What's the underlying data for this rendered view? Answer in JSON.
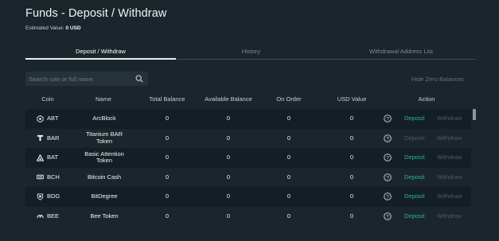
{
  "page": {
    "title": "Funds - Deposit / Withdraw",
    "estimated_label": "Estimated Value:",
    "estimated_value": "0 USD"
  },
  "tabs": [
    {
      "label": "Deposit / Withdraw",
      "active": true
    },
    {
      "label": "History",
      "active": false
    },
    {
      "label": "Withdrawal Address List",
      "active": false
    }
  ],
  "search": {
    "placeholder": "Search coin or full name",
    "value": "",
    "icon": "search-icon"
  },
  "hide_zero_label": "Hide Zero Balances",
  "table": {
    "headers": {
      "coin": "Coin",
      "name": "Name",
      "total": "Total Balance",
      "available": "Available Balance",
      "on_order": "On Order",
      "usd": "USD Value",
      "action": "Action"
    },
    "rows": [
      {
        "coin": "ABT",
        "name": "ArcBlock",
        "total": "0",
        "available": "0",
        "on_order": "0",
        "usd": "0",
        "deposit": "Deposit",
        "withdraw": "Withdraw",
        "deposit_enabled": true,
        "icon": "arcblock-icon"
      },
      {
        "coin": "BAR",
        "name": "Titanium BAR Token",
        "total": "0",
        "available": "0",
        "on_order": "0",
        "usd": "0",
        "deposit": "Deposit",
        "withdraw": "Withdraw",
        "deposit_enabled": false,
        "icon": "titanium-bar-icon"
      },
      {
        "coin": "BAT",
        "name": "Basic Attention Token",
        "total": "0",
        "available": "0",
        "on_order": "0",
        "usd": "0",
        "deposit": "Deposit",
        "withdraw": "Withdraw",
        "deposit_enabled": true,
        "icon": "bat-triangle-icon"
      },
      {
        "coin": "BCH",
        "name": "Bitcoin Cash",
        "total": "0",
        "available": "0",
        "on_order": "0",
        "usd": "0",
        "deposit": "Deposit",
        "withdraw": "Withdraw",
        "deposit_enabled": true,
        "icon": "bitcoin-cash-icon"
      },
      {
        "coin": "BDG",
        "name": "BitDegree",
        "total": "0",
        "available": "0",
        "on_order": "0",
        "usd": "0",
        "deposit": "Deposit",
        "withdraw": "Withdraw",
        "deposit_enabled": true,
        "icon": "bitdegree-icon"
      },
      {
        "coin": "BEE",
        "name": "Bee Token",
        "total": "0",
        "available": "0",
        "on_order": "0",
        "usd": "0",
        "deposit": "Deposit",
        "withdraw": "Withdraw",
        "deposit_enabled": true,
        "icon": "bee-token-icon"
      }
    ]
  },
  "colors": {
    "background": "#1b262c",
    "row_alt": "#141f25",
    "accent": "#2bb39a",
    "disabled": "#4e5a60"
  }
}
